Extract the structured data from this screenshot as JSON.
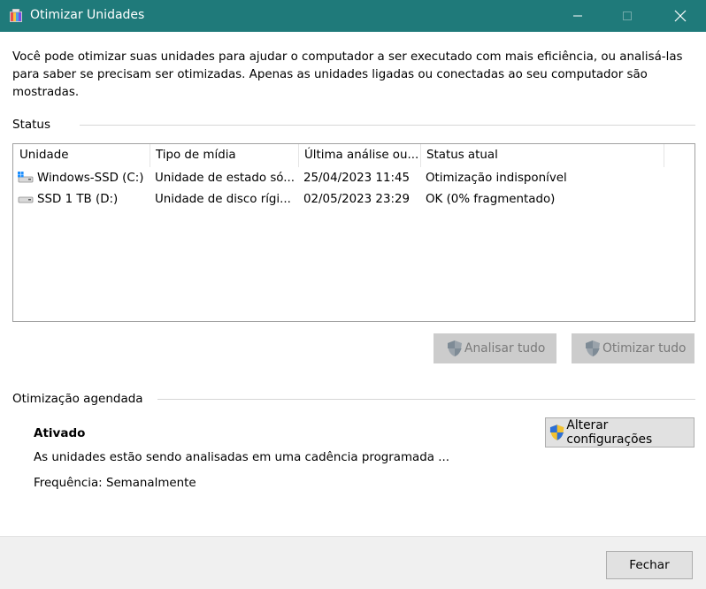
{
  "window": {
    "title": "Otimizar Unidades",
    "icon": "defrag-app-icon",
    "controls": [
      "minimize",
      "maximize",
      "close"
    ]
  },
  "description": "Você pode otimizar suas unidades para ajudar o computador a ser executado com mais eficiência, ou analisá-las para saber se precisam ser otimizadas. Apenas as unidades ligadas ou conectadas ao seu computador são mostradas.",
  "status": {
    "label": "Status",
    "columns": [
      "Unidade",
      "Tipo de mídia",
      "Última análise ou...",
      "Status atual"
    ],
    "drives": [
      {
        "name": "Windows-SSD (C:)",
        "icon": "windows-drive-icon",
        "media": "Unidade de estado só...",
        "last": "25/04/2023 11:45",
        "status": "Otimização indisponível"
      },
      {
        "name": "SSD 1 TB (D:)",
        "icon": "drive-icon",
        "media": "Unidade de disco rígi...",
        "last": "02/05/2023 23:29",
        "status": "OK (0% fragmentado)"
      }
    ],
    "analyze_all": "Analisar tudo",
    "optimize_all": "Otimizar tudo"
  },
  "scheduled": {
    "label": "Otimização agendada",
    "state": "Ativado",
    "info": "As unidades estão sendo analisadas em uma cadência programada ...",
    "frequency": "Frequência: Semanalmente",
    "change_settings": "Alterar configurações"
  },
  "close_label": "Fechar",
  "colors": {
    "titlebar": "#1f7a7a",
    "disabled_button": "#cccccc",
    "footer": "#f0f0f0"
  }
}
